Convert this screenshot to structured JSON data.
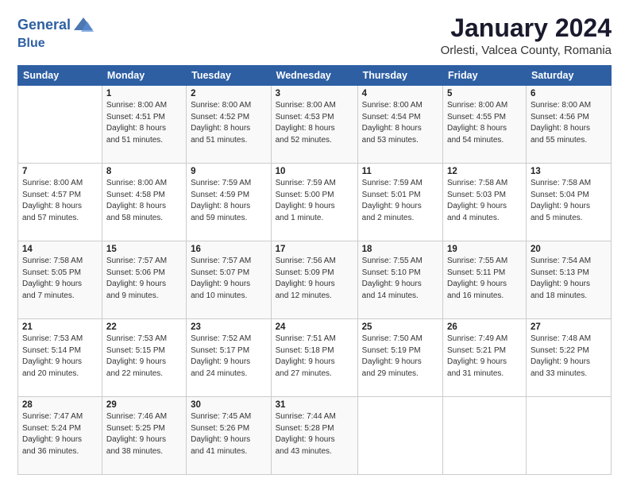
{
  "header": {
    "logo_line1": "General",
    "logo_line2": "Blue",
    "title": "January 2024",
    "subtitle": "Orlesti, Valcea County, Romania"
  },
  "weekdays": [
    "Sunday",
    "Monday",
    "Tuesday",
    "Wednesday",
    "Thursday",
    "Friday",
    "Saturday"
  ],
  "weeks": [
    [
      {
        "day": "",
        "info": ""
      },
      {
        "day": "1",
        "info": "Sunrise: 8:00 AM\nSunset: 4:51 PM\nDaylight: 8 hours\nand 51 minutes."
      },
      {
        "day": "2",
        "info": "Sunrise: 8:00 AM\nSunset: 4:52 PM\nDaylight: 8 hours\nand 51 minutes."
      },
      {
        "day": "3",
        "info": "Sunrise: 8:00 AM\nSunset: 4:53 PM\nDaylight: 8 hours\nand 52 minutes."
      },
      {
        "day": "4",
        "info": "Sunrise: 8:00 AM\nSunset: 4:54 PM\nDaylight: 8 hours\nand 53 minutes."
      },
      {
        "day": "5",
        "info": "Sunrise: 8:00 AM\nSunset: 4:55 PM\nDaylight: 8 hours\nand 54 minutes."
      },
      {
        "day": "6",
        "info": "Sunrise: 8:00 AM\nSunset: 4:56 PM\nDaylight: 8 hours\nand 55 minutes."
      }
    ],
    [
      {
        "day": "7",
        "info": "Sunrise: 8:00 AM\nSunset: 4:57 PM\nDaylight: 8 hours\nand 57 minutes."
      },
      {
        "day": "8",
        "info": "Sunrise: 8:00 AM\nSunset: 4:58 PM\nDaylight: 8 hours\nand 58 minutes."
      },
      {
        "day": "9",
        "info": "Sunrise: 7:59 AM\nSunset: 4:59 PM\nDaylight: 8 hours\nand 59 minutes."
      },
      {
        "day": "10",
        "info": "Sunrise: 7:59 AM\nSunset: 5:00 PM\nDaylight: 9 hours\nand 1 minute."
      },
      {
        "day": "11",
        "info": "Sunrise: 7:59 AM\nSunset: 5:01 PM\nDaylight: 9 hours\nand 2 minutes."
      },
      {
        "day": "12",
        "info": "Sunrise: 7:58 AM\nSunset: 5:03 PM\nDaylight: 9 hours\nand 4 minutes."
      },
      {
        "day": "13",
        "info": "Sunrise: 7:58 AM\nSunset: 5:04 PM\nDaylight: 9 hours\nand 5 minutes."
      }
    ],
    [
      {
        "day": "14",
        "info": "Sunrise: 7:58 AM\nSunset: 5:05 PM\nDaylight: 9 hours\nand 7 minutes."
      },
      {
        "day": "15",
        "info": "Sunrise: 7:57 AM\nSunset: 5:06 PM\nDaylight: 9 hours\nand 9 minutes."
      },
      {
        "day": "16",
        "info": "Sunrise: 7:57 AM\nSunset: 5:07 PM\nDaylight: 9 hours\nand 10 minutes."
      },
      {
        "day": "17",
        "info": "Sunrise: 7:56 AM\nSunset: 5:09 PM\nDaylight: 9 hours\nand 12 minutes."
      },
      {
        "day": "18",
        "info": "Sunrise: 7:55 AM\nSunset: 5:10 PM\nDaylight: 9 hours\nand 14 minutes."
      },
      {
        "day": "19",
        "info": "Sunrise: 7:55 AM\nSunset: 5:11 PM\nDaylight: 9 hours\nand 16 minutes."
      },
      {
        "day": "20",
        "info": "Sunrise: 7:54 AM\nSunset: 5:13 PM\nDaylight: 9 hours\nand 18 minutes."
      }
    ],
    [
      {
        "day": "21",
        "info": "Sunrise: 7:53 AM\nSunset: 5:14 PM\nDaylight: 9 hours\nand 20 minutes."
      },
      {
        "day": "22",
        "info": "Sunrise: 7:53 AM\nSunset: 5:15 PM\nDaylight: 9 hours\nand 22 minutes."
      },
      {
        "day": "23",
        "info": "Sunrise: 7:52 AM\nSunset: 5:17 PM\nDaylight: 9 hours\nand 24 minutes."
      },
      {
        "day": "24",
        "info": "Sunrise: 7:51 AM\nSunset: 5:18 PM\nDaylight: 9 hours\nand 27 minutes."
      },
      {
        "day": "25",
        "info": "Sunrise: 7:50 AM\nSunset: 5:19 PM\nDaylight: 9 hours\nand 29 minutes."
      },
      {
        "day": "26",
        "info": "Sunrise: 7:49 AM\nSunset: 5:21 PM\nDaylight: 9 hours\nand 31 minutes."
      },
      {
        "day": "27",
        "info": "Sunrise: 7:48 AM\nSunset: 5:22 PM\nDaylight: 9 hours\nand 33 minutes."
      }
    ],
    [
      {
        "day": "28",
        "info": "Sunrise: 7:47 AM\nSunset: 5:24 PM\nDaylight: 9 hours\nand 36 minutes."
      },
      {
        "day": "29",
        "info": "Sunrise: 7:46 AM\nSunset: 5:25 PM\nDaylight: 9 hours\nand 38 minutes."
      },
      {
        "day": "30",
        "info": "Sunrise: 7:45 AM\nSunset: 5:26 PM\nDaylight: 9 hours\nand 41 minutes."
      },
      {
        "day": "31",
        "info": "Sunrise: 7:44 AM\nSunset: 5:28 PM\nDaylight: 9 hours\nand 43 minutes."
      },
      {
        "day": "",
        "info": ""
      },
      {
        "day": "",
        "info": ""
      },
      {
        "day": "",
        "info": ""
      }
    ]
  ]
}
